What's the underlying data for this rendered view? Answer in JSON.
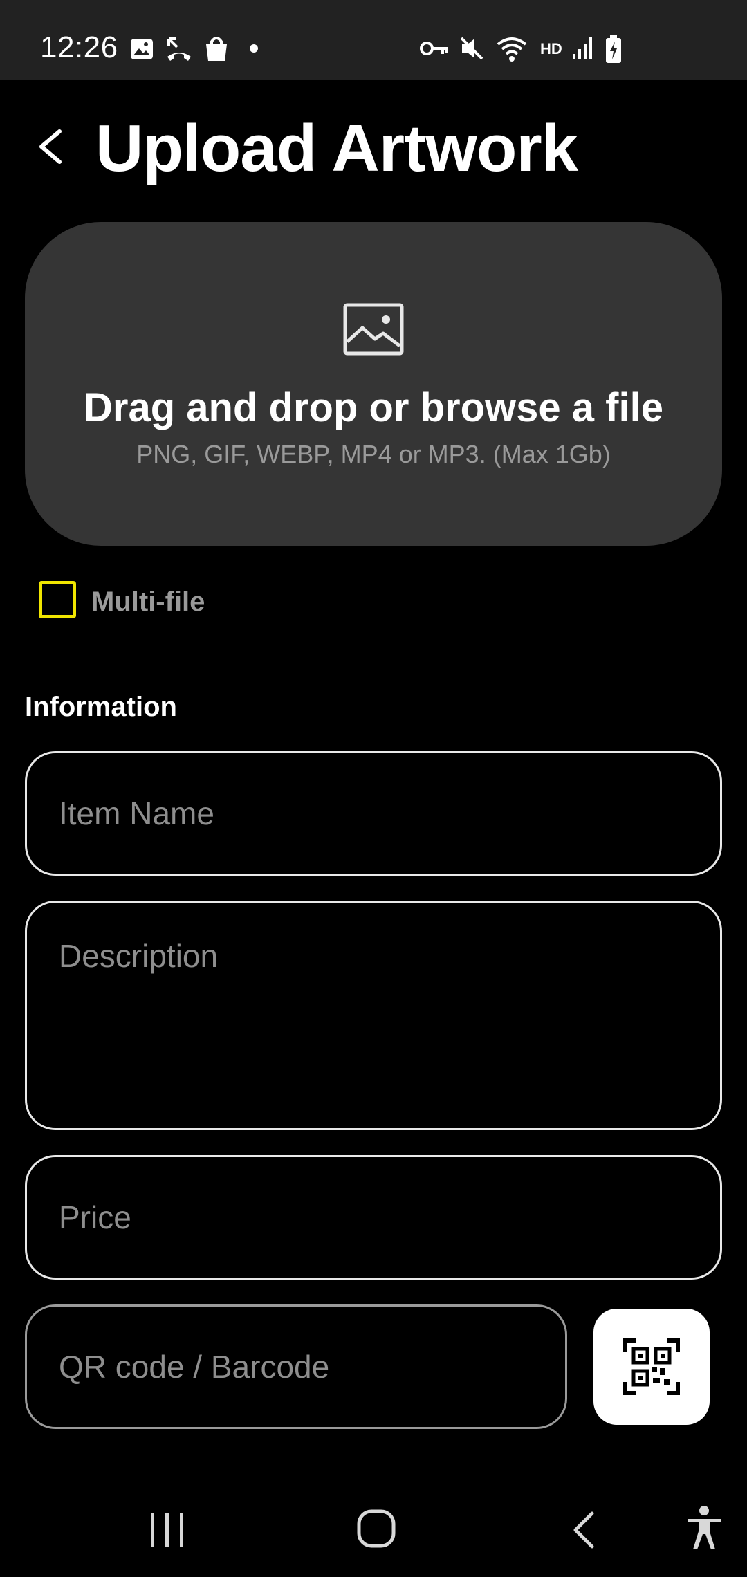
{
  "status_bar": {
    "time": "12:26",
    "network_label": "HD",
    "icons": [
      "image-icon",
      "missed-call-icon",
      "shopping-bag-icon",
      "notification-dot",
      "vpn-key-icon",
      "mute-icon",
      "wifi-icon",
      "signal-icon",
      "battery-charging-icon"
    ]
  },
  "header": {
    "back_icon": "chevron-left-icon",
    "title": "Upload Artwork"
  },
  "upload": {
    "icon": "image-icon",
    "title": "Drag and drop or browse a file",
    "subtitle": "PNG, GIF, WEBP, MP4 or MP3. (Max 1Gb)"
  },
  "multi_file": {
    "label": "Multi-file",
    "checked": false,
    "accent": "#f0e500"
  },
  "information": {
    "heading": "Information",
    "item_name_placeholder": "Item Name",
    "description_placeholder": "Description",
    "price_placeholder": "Price",
    "qr_placeholder": "QR code / Barcode",
    "qr_button_icon": "qr-scan-icon"
  },
  "nav_bar": {
    "items": [
      "recents-icon",
      "home-icon",
      "back-icon",
      "accessibility-icon"
    ]
  }
}
